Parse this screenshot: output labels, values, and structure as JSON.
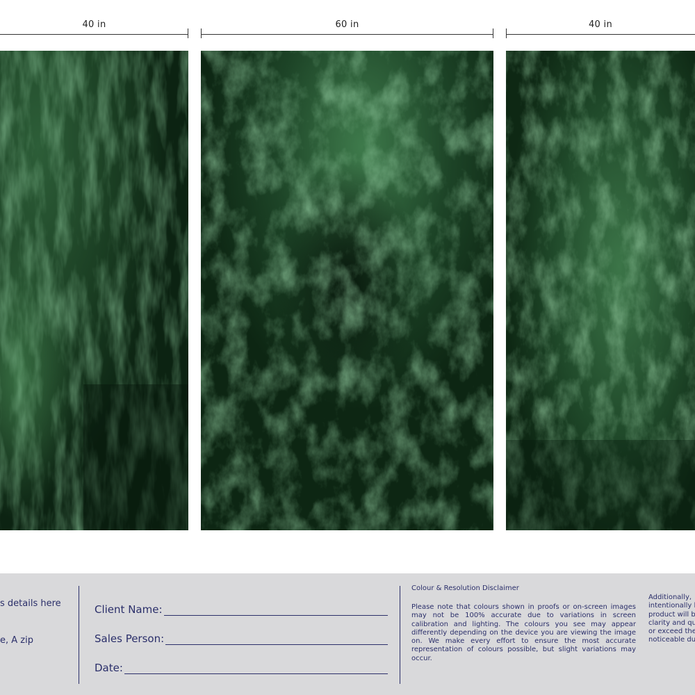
{
  "dimensions": {
    "left": "40 in",
    "center": "60 in",
    "right": "40 in"
  },
  "panels": {
    "image_description": "green-textured-fiber-art-triptych",
    "base_color": "#0e2a16",
    "highlight_color": "#4f9a60"
  },
  "footer": {
    "contact_line1": "s details here",
    "contact_line2": "e, A zip",
    "client_name_label": "Client Name:",
    "sales_person_label": "Sales Person:",
    "date_label": "Date:",
    "disclaimer_title": "Colour & Resolution Disclaimer",
    "disclaimer_body": "Please note that colours shown in proofs or on-screen images may not be 100% accurate due to variations in screen calibration and lighting. The colours you see may appear differently depending on the device you are viewing the image on. We make every effort to ensure the most accurate representation of colours possible, but slight variations may occur.",
    "disclaimer2_lines": [
      "Additionally,",
      "intentionally l",
      "product will b",
      "clarity and qu",
      "or exceed the",
      "noticeable du"
    ],
    "text_color": "#2b2f6a",
    "background_color": "#d9d9db"
  }
}
